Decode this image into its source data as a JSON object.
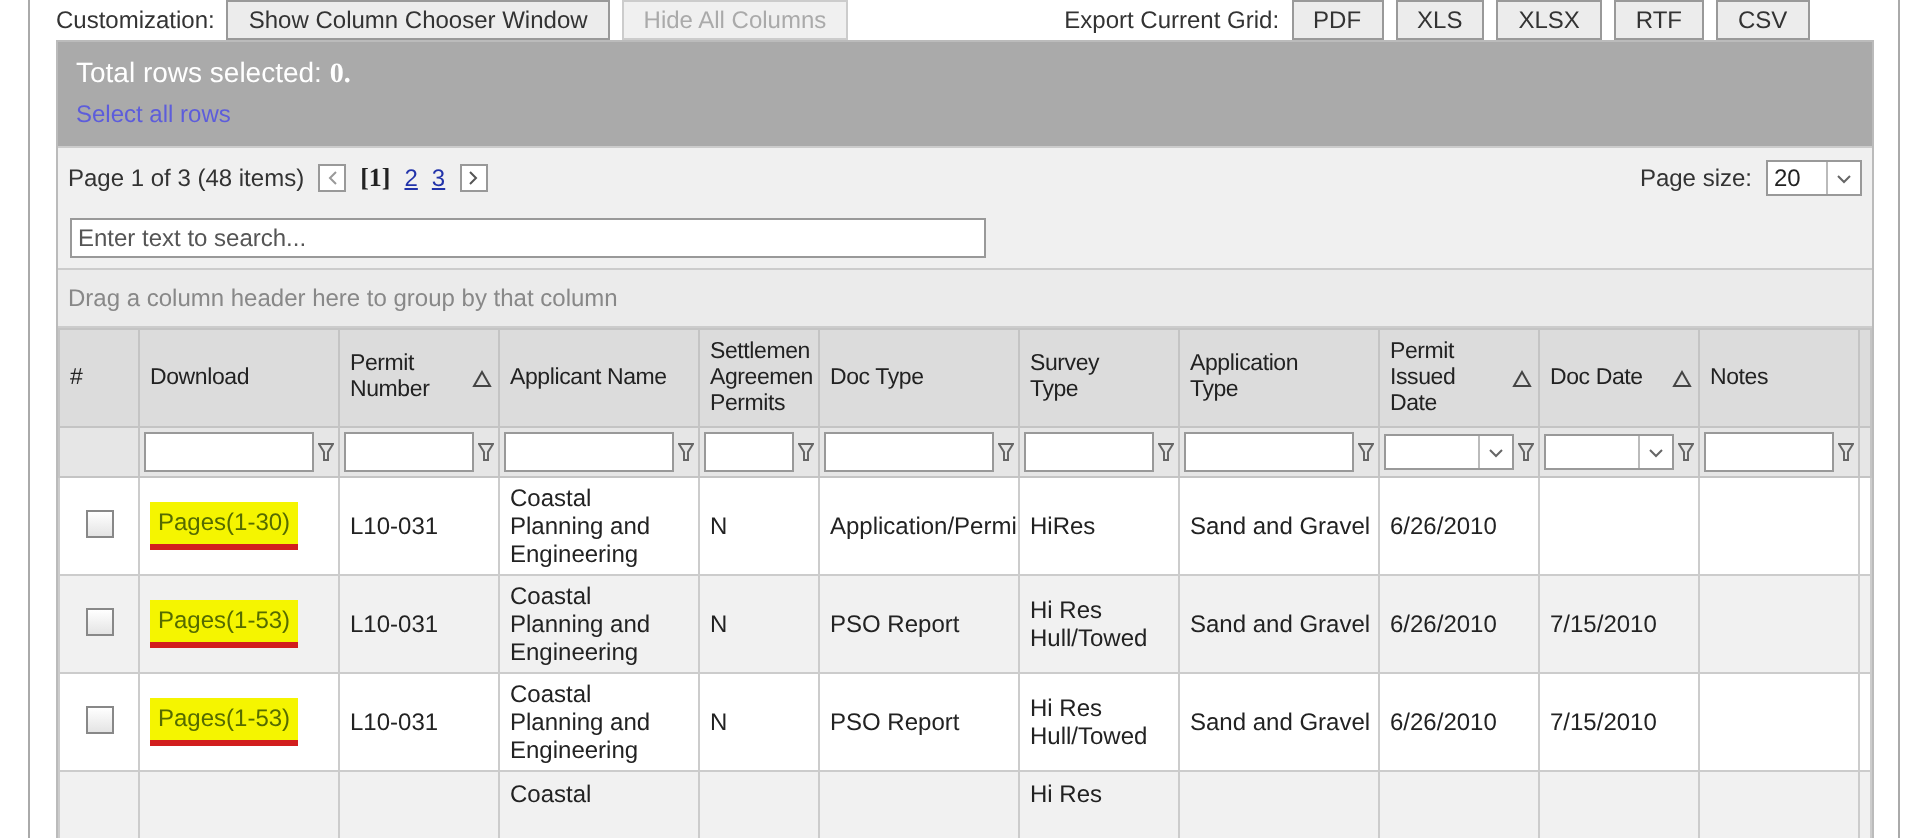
{
  "toolbar": {
    "customization_label": "Customization:",
    "buttons": [
      {
        "label": "Show Column Chooser Window",
        "disabled": false
      },
      {
        "label": "Hide All Columns",
        "disabled": true
      }
    ],
    "export_label": "Export Current Grid:",
    "export_buttons": [
      "PDF",
      "XLS",
      "XLSX",
      "RTF",
      "CSV"
    ]
  },
  "selection": {
    "label": "Total rows selected: ",
    "count": "0.",
    "select_all": "Select all rows"
  },
  "pager": {
    "summary": "Page 1 of 3 (48 items)",
    "pages": [
      {
        "label": "[1]",
        "selected": true
      },
      {
        "label": "2",
        "selected": false
      },
      {
        "label": "3",
        "selected": false
      }
    ],
    "page_size_label": "Page size:",
    "page_size": "20"
  },
  "search": {
    "placeholder": "Enter text to search..."
  },
  "group_panel": "Drag a column header here to group by that column",
  "columns": [
    {
      "label": "#",
      "sorted": false,
      "kind": "none"
    },
    {
      "label": "Download",
      "sorted": false,
      "kind": "text"
    },
    {
      "label": "Permit\nNumber",
      "sorted": true,
      "kind": "text"
    },
    {
      "label": "Applicant Name",
      "sorted": false,
      "kind": "text"
    },
    {
      "label": "Settlemen\nAgreemen\nPermits",
      "sorted": false,
      "kind": "text"
    },
    {
      "label": "Doc Type",
      "sorted": false,
      "kind": "text"
    },
    {
      "label": "Survey\nType",
      "sorted": false,
      "kind": "text"
    },
    {
      "label": "Application\nType",
      "sorted": false,
      "kind": "text"
    },
    {
      "label": "Permit\nIssued\nDate",
      "sorted": true,
      "kind": "date"
    },
    {
      "label": "Doc Date",
      "sorted": true,
      "kind": "date"
    },
    {
      "label": "Notes",
      "sorted": false,
      "kind": "text"
    }
  ],
  "rows": [
    {
      "checked": false,
      "download": "Pages(1-30)",
      "highlighted": true,
      "permit_number": "L10-031",
      "applicant": "Coastal\nPlanning and\nEngineering",
      "settlement": "N",
      "doc_type": "Application/Permi",
      "survey_type": "HiRes",
      "application_type": "Sand and Gravel",
      "issued": "6/26/2010",
      "doc_date": "",
      "notes": ""
    },
    {
      "checked": false,
      "download": "Pages(1-53)",
      "highlighted": true,
      "permit_number": "L10-031",
      "applicant": "Coastal\nPlanning and\nEngineering",
      "settlement": "N",
      "doc_type": "PSO Report",
      "survey_type": "Hi Res\nHull/Towed",
      "application_type": "Sand and Gravel",
      "issued": "6/26/2010",
      "doc_date": "7/15/2010",
      "notes": ""
    },
    {
      "checked": false,
      "download": "Pages(1-53)",
      "highlighted": true,
      "permit_number": "L10-031",
      "applicant": "Coastal\nPlanning and\nEngineering",
      "settlement": "N",
      "doc_type": "PSO Report",
      "survey_type": "Hi Res\nHull/Towed",
      "application_type": "Sand and Gravel",
      "issued": "6/26/2010",
      "doc_date": "7/15/2010",
      "notes": ""
    }
  ],
  "partial_row": {
    "applicant": "Coastal",
    "survey_type": "Hi Res"
  }
}
